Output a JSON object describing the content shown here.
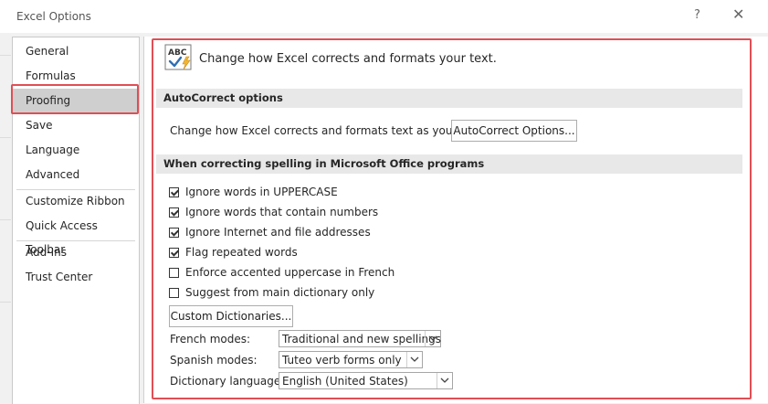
{
  "window": {
    "title": "Excel Options",
    "help": "?",
    "close": "✕"
  },
  "sidebar": {
    "items": [
      {
        "label": "General"
      },
      {
        "label": "Formulas"
      },
      {
        "label": "Proofing"
      },
      {
        "label": "Save"
      },
      {
        "label": "Language"
      },
      {
        "label": "Advanced"
      },
      {
        "label": "Customize Ribbon"
      },
      {
        "label": "Quick Access Toolbar"
      },
      {
        "label": "Add-Ins"
      },
      {
        "label": "Trust Center"
      }
    ],
    "selected": "Proofing"
  },
  "main": {
    "header_text": "Change how Excel corrects and formats your text.",
    "autocorrect": {
      "section_title": "AutoCorrect options",
      "description": "Change how Excel corrects and formats text as you type:",
      "button_label": "AutoCorrect Options..."
    },
    "spelling": {
      "section_title": "When correcting spelling in Microsoft Office programs",
      "options": [
        {
          "label": "Ignore words in UPPERCASE",
          "checked": true
        },
        {
          "label": "Ignore words that contain numbers",
          "checked": true
        },
        {
          "label": "Ignore Internet and file addresses",
          "checked": true
        },
        {
          "label": "Flag repeated words",
          "checked": true
        },
        {
          "label": "Enforce accented uppercase in French",
          "checked": false
        },
        {
          "label": "Suggest from main dictionary only",
          "checked": false
        }
      ],
      "custom_dictionaries_label": "Custom Dictionaries...",
      "french_modes": {
        "label": "French modes:",
        "value": "Traditional and new spellings"
      },
      "spanish_modes": {
        "label": "Spanish modes:",
        "value": "Tuteo verb forms only"
      },
      "dictionary_language": {
        "label": "Dictionary language:",
        "value": "English (United States)"
      }
    }
  },
  "colors": {
    "highlight_border": "#e04e55",
    "selected_nav": "#cfcfcf",
    "section_bg": "#e8e8e8"
  },
  "icons": {
    "abc": "abc-check-icon"
  }
}
